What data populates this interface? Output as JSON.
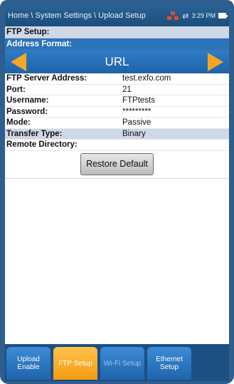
{
  "header": {
    "breadcrumb": "Home \\ System Settings \\ Upload Setup",
    "time": "3:29 PM",
    "icons": [
      "network-icon",
      "sync-icon",
      "battery-icon"
    ]
  },
  "ftp": {
    "section_title": "FTP Setup:",
    "address_format_label": "Address Format:",
    "address_format_value": "URL",
    "rows": [
      {
        "label": "FTP Server Address:",
        "value": "test.exfo.com"
      },
      {
        "label": "Port:",
        "value": "21"
      },
      {
        "label": "Username:",
        "value": "FTPtests"
      },
      {
        "label": "Password:",
        "value": "*********"
      },
      {
        "label": "Mode:",
        "value": "Passive"
      },
      {
        "label": "Transfer Type:",
        "value": "Binary"
      },
      {
        "label": "Remote Directory:",
        "value": ""
      }
    ],
    "restore_label": "Restore Default"
  },
  "tabs": [
    {
      "label": "Upload Enable",
      "state": "normal"
    },
    {
      "label": "FTP Setup",
      "state": "active"
    },
    {
      "label": "Wi-Fi Setup",
      "state": "disabled"
    },
    {
      "label": "Ethernet Setup",
      "state": "normal"
    }
  ],
  "colors": {
    "header": "#1c4d7c",
    "accent_orange": "#f6a623",
    "selector_blue": "#2d73b8",
    "row_highlight": "#cfd8e6"
  }
}
